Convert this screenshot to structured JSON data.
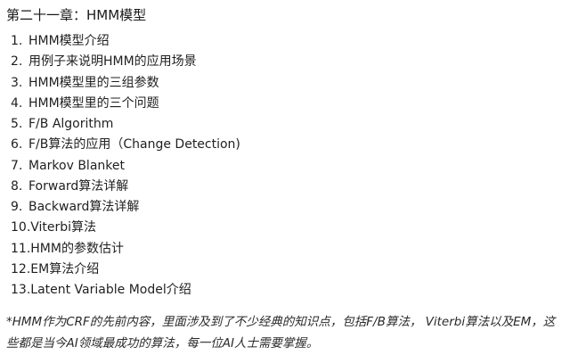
{
  "title": "第二十一章：HMM模型",
  "toc": [
    {
      "num": "1.",
      "label": "HMM模型介绍"
    },
    {
      "num": "2.",
      "label": "用例子来说明HMM的应用场景"
    },
    {
      "num": "3.",
      "label": "HMM模型里的三组参数"
    },
    {
      "num": "4.",
      "label": "HMM模型里的三个问题"
    },
    {
      "num": "5.",
      "label": "F/B Algorithm"
    },
    {
      "num": "6.",
      "label": "F/B算法的应用（Change Detection)"
    },
    {
      "num": "7.",
      "label": "Markov Blanket"
    },
    {
      "num": "8.",
      "label": "Forward算法详解"
    },
    {
      "num": "9.",
      "label": "Backward算法详解"
    },
    {
      "num": "10.",
      "label": "Viterbi算法"
    },
    {
      "num": "11.",
      "label": "HMM的参数估计"
    },
    {
      "num": "12.",
      "label": "EM算法介绍"
    },
    {
      "num": "13.",
      "label": "Latent Variable Model介绍"
    }
  ],
  "note": "*HMM作为CRF的先前内容，里面涉及到了不少经典的知识点，包括F/B算法， Viterbi算法以及EM，这些都是当今AI领域最成功的算法，每一位AI人士需要掌握。"
}
